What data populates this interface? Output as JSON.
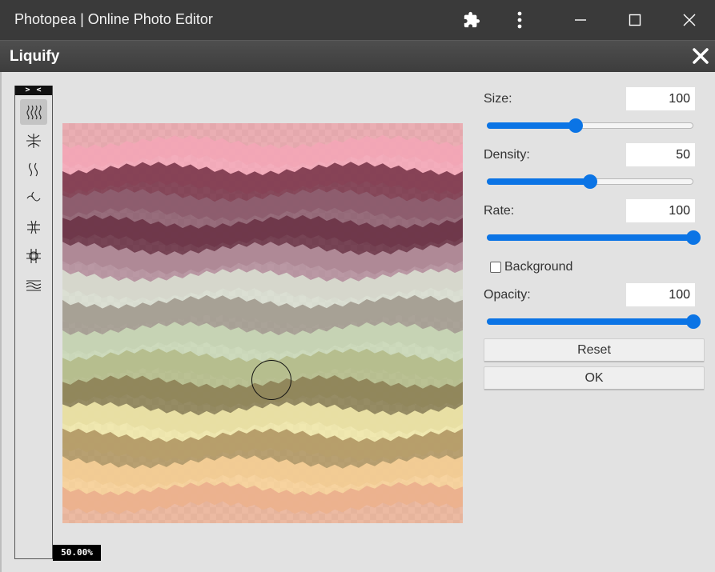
{
  "window": {
    "title": "Photopea | Online Photo Editor",
    "icons": [
      "puzzle-icon",
      "more-vertical-icon",
      "minimize-icon",
      "maximize-icon",
      "close-icon"
    ]
  },
  "dialog": {
    "title": "Liquify",
    "close_icon": "close-icon"
  },
  "tools": {
    "collapse_label": "> <",
    "items": [
      "forward-warp-icon",
      "pucker-icon",
      "twirl-icon",
      "bloat-icon",
      "push-left-icon",
      "reconstruct-icon",
      "turbulence-icon"
    ],
    "active_index": 0
  },
  "canvas": {
    "zoom": "50.00%",
    "band_colors": [
      "#e79aa0",
      "#f3a6b6",
      "#7d3a4d",
      "#8e6070",
      "#6b3446",
      "#b48f9c",
      "#d8dccf",
      "#a39b8f",
      "#c9d7b6",
      "#b4bc8a",
      "#8d8257",
      "#efe6a9",
      "#b29865",
      "#f6cf97",
      "#e9a98a"
    ]
  },
  "controls": {
    "size": {
      "label": "Size:",
      "value": "100",
      "fraction": 0.43
    },
    "density": {
      "label": "Density:",
      "value": "50",
      "fraction": 0.5
    },
    "rate": {
      "label": "Rate:",
      "value": "100",
      "fraction": 1.0
    },
    "background": {
      "label": "Background",
      "checked": false
    },
    "opacity": {
      "label": "Opacity:",
      "value": "100",
      "fraction": 1.0
    }
  },
  "buttons": {
    "reset": "Reset",
    "ok": "OK"
  },
  "accent_color": "#0b74e5"
}
